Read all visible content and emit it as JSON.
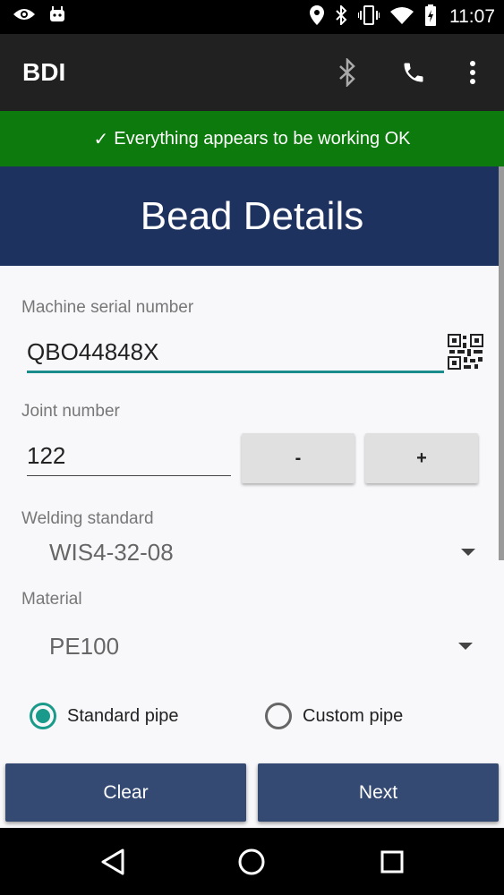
{
  "status_bar": {
    "time": "11:07"
  },
  "app_bar": {
    "title": "BDI"
  },
  "banner": {
    "check": "✓",
    "text": "Everything appears to be working OK"
  },
  "header": {
    "title": "Bead Details"
  },
  "form": {
    "serial": {
      "label": "Machine serial number",
      "value": "QBO44848X"
    },
    "joint": {
      "label": "Joint number",
      "value": "122",
      "minus_label": "-",
      "plus_label": "+"
    },
    "welding_standard": {
      "label": "Welding standard",
      "value": "WIS4-32-08"
    },
    "material": {
      "label": "Material",
      "value": "PE100"
    },
    "pipe_type": {
      "options": [
        {
          "label": "Standard pipe",
          "selected": true
        },
        {
          "label": "Custom pipe",
          "selected": false
        }
      ]
    }
  },
  "actions": {
    "clear_label": "Clear",
    "next_label": "Next"
  },
  "colors": {
    "banner_green": "#0c7a0c",
    "header_navy": "#1e3260",
    "button_navy": "#354a73",
    "accent_teal": "#1a9a8a"
  }
}
